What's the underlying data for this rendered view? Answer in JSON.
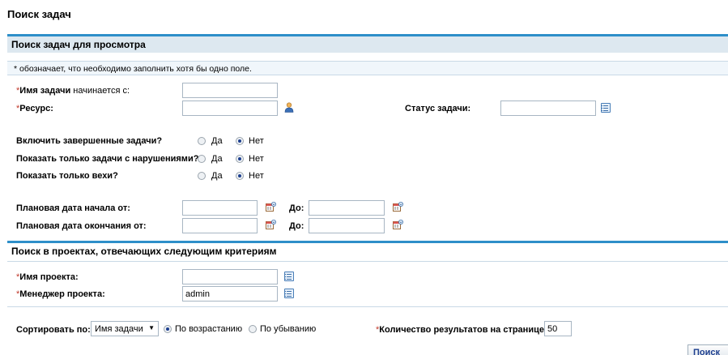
{
  "page": {
    "title": "Поиск задач"
  },
  "section1": {
    "title": "Поиск задач для просмотра",
    "info": "* обозначает, что необходимо заполнить хотя бы одно поле.",
    "task_name": {
      "label_bold": "Имя задачи",
      "label_rest": " начинается с:",
      "value": ""
    },
    "resource": {
      "label": "Ресурс:",
      "value": ""
    },
    "task_status": {
      "label": "Статус задачи:",
      "value": ""
    },
    "include_completed": {
      "label": "Включить завершенные задачи?",
      "yes": "Да",
      "no": "Нет",
      "selected": "no"
    },
    "only_violations": {
      "label": "Показать только задачи с нарушениями?",
      "yes": "Да",
      "no": "Нет",
      "selected": "no"
    },
    "only_milestones": {
      "label": "Показать только вехи?",
      "yes": "Да",
      "no": "Нет",
      "selected": "no"
    },
    "planned_start": {
      "label": "Плановая дата начала от:",
      "to_label": "До:",
      "from_value": "",
      "to_value": ""
    },
    "planned_finish": {
      "label": "Плановая дата окончания от:",
      "to_label": "До:",
      "from_value": "",
      "to_value": ""
    }
  },
  "section2": {
    "title": "Поиск в проектах, отвечающих следующим критериям",
    "project_name": {
      "label": "Имя проекта:",
      "value": ""
    },
    "project_manager": {
      "label": "Менеджер проекта:",
      "value": "admin"
    }
  },
  "sort": {
    "label": "Сортировать по:",
    "selected": "Имя задачи",
    "asc_label": "По возрастанию",
    "desc_label": "По убыванию",
    "order": "asc"
  },
  "results_per_page": {
    "label": "Количество результатов на странице:",
    "value": "50"
  },
  "buttons": {
    "search": "Поиск"
  },
  "colors": {
    "accent": "#2e8fc9",
    "section_bg": "#dde8f0",
    "required_star": "#c0392b"
  }
}
